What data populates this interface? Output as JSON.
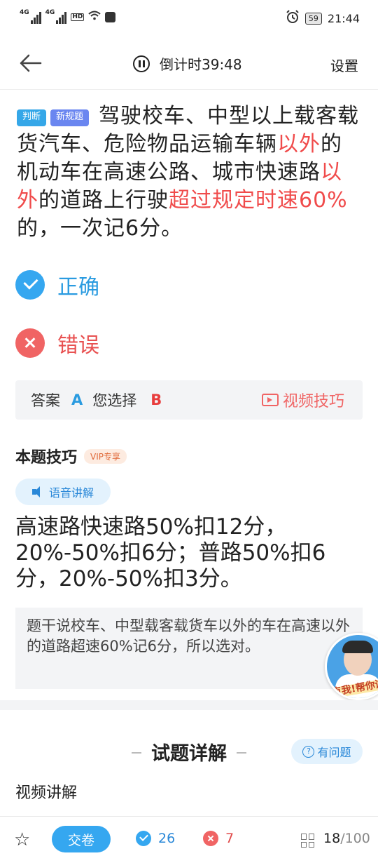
{
  "status_bar": {
    "signal1": "4G",
    "signal2": "4G",
    "hd": "1 2\nHD",
    "battery": "59",
    "time": "21:44"
  },
  "header": {
    "countdown": "倒计时39:48",
    "settings": "设置"
  },
  "question": {
    "tag_type": "判断",
    "tag_new": "新规题",
    "text_1": "驾驶校车、中型以上载客载货汽车、危险物品运输车辆",
    "text_2_red": "以外",
    "text_3": "的机动车在高速公路、城市快速路",
    "text_4_red": "以外",
    "text_5": "的道路上行驶",
    "text_6_red": "超过规定时速60%",
    "text_7": "的，一次记6分。"
  },
  "options": {
    "correct": "正确",
    "wrong": "错误"
  },
  "answer_bar": {
    "answer_label": "答案",
    "answer_value": "A",
    "selected_label": "您选择",
    "selected_value": "B",
    "video_tip": "视频技巧"
  },
  "tips": {
    "title": "本题技巧",
    "vip_badge": "VIP专享",
    "voice_button": "语音讲解",
    "text": "高速路快速路50%扣12分，20%-50%扣6分；普路50%扣6分，20%-50%扣3分。",
    "explanation": "题干说校车、中型载客载货车以外的车在高速以外的道路超速60%记6分，所以选对。"
  },
  "floating_avatar": {
    "text": "点我!帮你讲"
  },
  "detail": {
    "title": "试题详解",
    "ask_button": "有问题",
    "video_explain": "视频讲解"
  },
  "bottom_bar": {
    "submit": "交卷",
    "correct_count": "26",
    "wrong_count": "7",
    "current": "18",
    "total": "/100"
  },
  "colors": {
    "accent_blue": "#35a7f0",
    "error_red": "#f06464",
    "highlight_red": "#f04b4b"
  }
}
